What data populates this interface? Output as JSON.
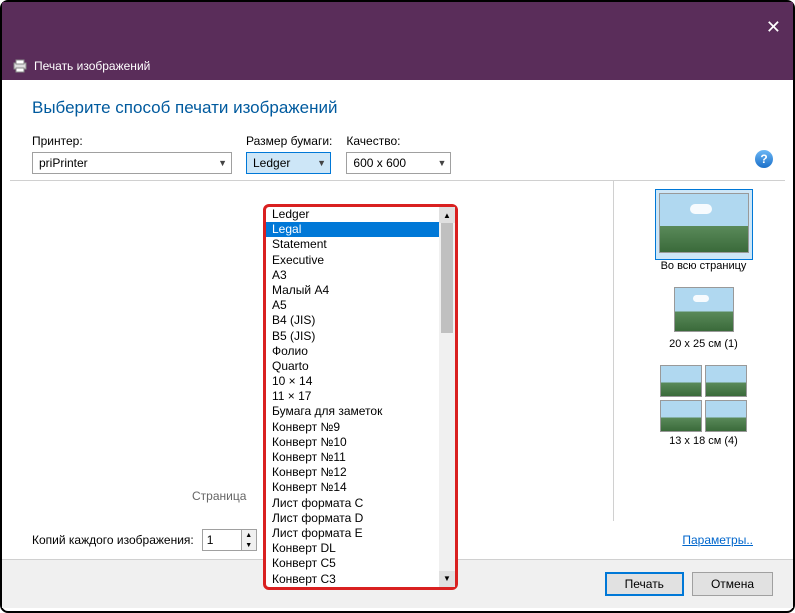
{
  "titlebar": {
    "close": "✕"
  },
  "subheader": {
    "title": "Печать изображений"
  },
  "heading": "Выберите способ печати изображений",
  "controls": {
    "printer": {
      "label": "Принтер:",
      "value": "priPrinter"
    },
    "paper": {
      "label": "Размер бумаги:",
      "value": "Ledger"
    },
    "quality": {
      "label": "Качество:",
      "value": "600 x 600"
    }
  },
  "dropdown": {
    "items": [
      "Ledger",
      "Legal",
      "Statement",
      "Executive",
      "A3",
      "Малый A4",
      "A5",
      "B4 (JIS)",
      "B5 (JIS)",
      "Фолио",
      "Quarto",
      "10 × 14",
      "11 × 17",
      "Бумага для заметок",
      "Конверт №9",
      "Конверт №10",
      "Конверт №11",
      "Конверт №12",
      "Конверт №14",
      "Лист формата C",
      "Лист формата D",
      "Лист формата E",
      "Конверт DL",
      "Конверт C5",
      "Конверт C3"
    ],
    "highlighted": "Legal"
  },
  "preview": {
    "page_label": "Страница"
  },
  "layouts": {
    "items": [
      {
        "label": "Во всю страницу"
      },
      {
        "label": "20 x 25 см (1)"
      },
      {
        "label": "13 x 18 см (4)"
      }
    ]
  },
  "bottom": {
    "copies_label": "Копий каждого изображения:",
    "copies_value": "1",
    "params": "Параметры.."
  },
  "footer": {
    "print": "Печать",
    "cancel": "Отмена"
  }
}
